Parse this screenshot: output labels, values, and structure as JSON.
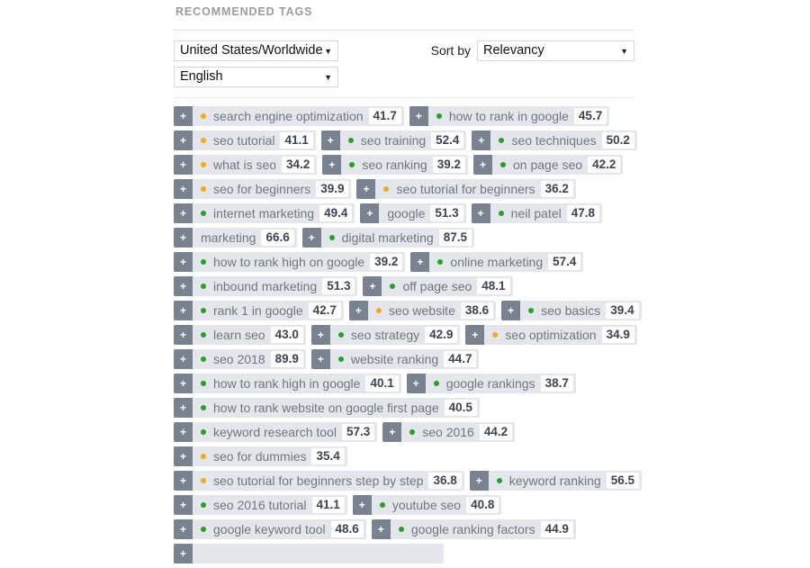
{
  "header": {
    "section_title": "RECOMMENDED TAGS"
  },
  "controls": {
    "geo_select": {
      "value": "United States/Worldwide",
      "caret": "▼"
    },
    "language_select": {
      "value": "English",
      "caret": "▼"
    },
    "sort_by_label": "Sort by",
    "sort_select": {
      "value": "Relevancy",
      "caret": "▼"
    }
  },
  "tag_ui": {
    "add_label": "+",
    "colors": {
      "pill_bg": "#e3e6ea",
      "plus_bg": "#79838f",
      "label_text": "#6e7782",
      "score_text": "#3c4450",
      "dot_green": "#2e9b2e",
      "dot_orange": "#f5a623"
    }
  },
  "tag_rows": [
    [
      {
        "label": "search engine optimization",
        "score": "41.7",
        "dot": "orange"
      },
      {
        "label": "how to rank in google",
        "score": "45.7",
        "dot": "green"
      }
    ],
    [
      {
        "label": "seo tutorial",
        "score": "41.1",
        "dot": "orange"
      },
      {
        "label": "seo training",
        "score": "52.4",
        "dot": "green"
      },
      {
        "label": "seo techniques",
        "score": "50.2",
        "dot": "green"
      }
    ],
    [
      {
        "label": "what is seo",
        "score": "34.2",
        "dot": "orange"
      },
      {
        "label": "seo ranking",
        "score": "39.2",
        "dot": "green"
      },
      {
        "label": "on page seo",
        "score": "42.2",
        "dot": "green"
      }
    ],
    [
      {
        "label": "seo for beginners",
        "score": "39.9",
        "dot": "orange"
      },
      {
        "label": "seo tutorial for beginners",
        "score": "36.2",
        "dot": "orange"
      }
    ],
    [
      {
        "label": "internet marketing",
        "score": "49.4",
        "dot": "green"
      },
      {
        "label": "google",
        "score": "51.3",
        "dot": "none"
      },
      {
        "label": "neil patel",
        "score": "47.8",
        "dot": "green"
      }
    ],
    [
      {
        "label": "marketing",
        "score": "66.6",
        "dot": "none"
      },
      {
        "label": "digital marketing",
        "score": "87.5",
        "dot": "green"
      }
    ],
    [
      {
        "label": "how to rank high on google",
        "score": "39.2",
        "dot": "green"
      },
      {
        "label": "online marketing",
        "score": "57.4",
        "dot": "green"
      }
    ],
    [
      {
        "label": "inbound marketing",
        "score": "51.3",
        "dot": "green"
      },
      {
        "label": "off page seo",
        "score": "48.1",
        "dot": "green"
      }
    ],
    [
      {
        "label": "rank 1 in google",
        "score": "42.7",
        "dot": "green"
      },
      {
        "label": "seo website",
        "score": "38.6",
        "dot": "orange"
      },
      {
        "label": "seo basics",
        "score": "39.4",
        "dot": "green"
      }
    ],
    [
      {
        "label": "learn seo",
        "score": "43.0",
        "dot": "green"
      },
      {
        "label": "seo strategy",
        "score": "42.9",
        "dot": "green"
      },
      {
        "label": "seo optimization",
        "score": "34.9",
        "dot": "orange"
      }
    ],
    [
      {
        "label": "seo 2018",
        "score": "89.9",
        "dot": "green"
      },
      {
        "label": "website ranking",
        "score": "44.7",
        "dot": "green"
      }
    ],
    [
      {
        "label": "how to rank high in google",
        "score": "40.1",
        "dot": "green"
      },
      {
        "label": "google rankings",
        "score": "38.7",
        "dot": "green"
      }
    ],
    [
      {
        "label": "how to rank website on google first page",
        "score": "40.5",
        "dot": "green"
      }
    ],
    [
      {
        "label": "keyword research tool",
        "score": "57.3",
        "dot": "green"
      },
      {
        "label": "seo 2016",
        "score": "44.2",
        "dot": "green"
      }
    ],
    [
      {
        "label": "seo for dummies",
        "score": "35.4",
        "dot": "orange"
      }
    ],
    [
      {
        "label": "seo tutorial for beginners step by step",
        "score": "36.8",
        "dot": "orange"
      },
      {
        "label": "keyword ranking",
        "score": "56.5",
        "dot": "green"
      }
    ],
    [
      {
        "label": "seo 2016 tutorial",
        "score": "41.1",
        "dot": "green"
      },
      {
        "label": "youtube seo",
        "score": "40.8",
        "dot": "green"
      }
    ],
    [
      {
        "label": "google keyword tool",
        "score": "48.6",
        "dot": "green"
      },
      {
        "label": "google ranking factors",
        "score": "44.9",
        "dot": "green"
      }
    ],
    [
      {
        "label": "",
        "score": "",
        "dot": "none"
      }
    ]
  ]
}
